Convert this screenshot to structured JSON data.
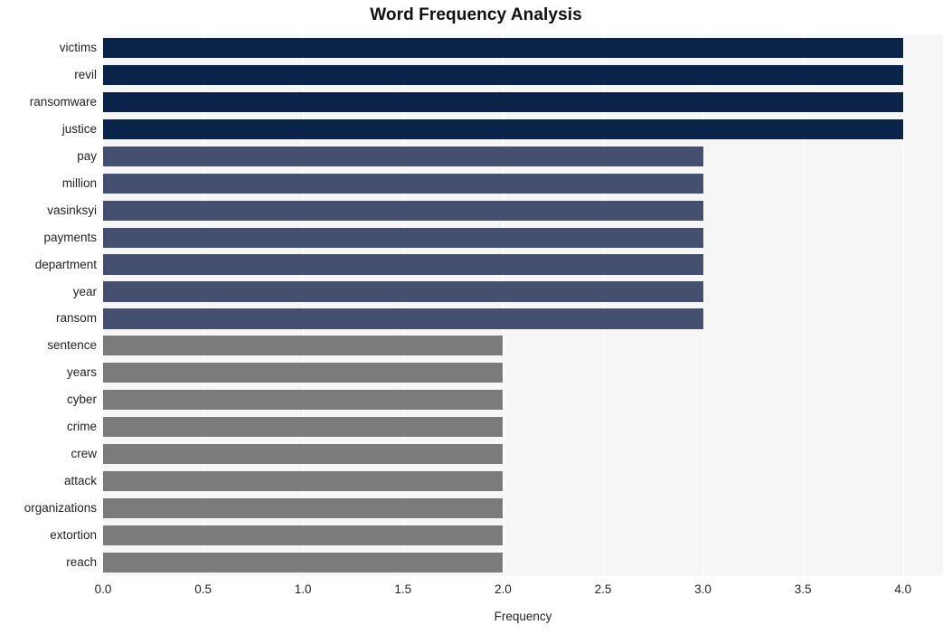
{
  "chart_data": {
    "type": "bar",
    "orientation": "horizontal",
    "title": "Word Frequency Analysis",
    "xlabel": "Frequency",
    "ylabel": "",
    "xlim": [
      0.0,
      4.2
    ],
    "ylim": null,
    "grid": true,
    "legend": null,
    "x_ticks": [
      "0.0",
      "0.5",
      "1.0",
      "1.5",
      "2.0",
      "2.5",
      "3.0",
      "3.5",
      "4.0"
    ],
    "x_tick_values": [
      0.0,
      0.5,
      1.0,
      1.5,
      2.0,
      2.5,
      3.0,
      3.5,
      4.0
    ],
    "categories": [
      "victims",
      "revil",
      "ransomware",
      "justice",
      "pay",
      "million",
      "vasinksyi",
      "payments",
      "department",
      "year",
      "ransom",
      "sentence",
      "years",
      "cyber",
      "crime",
      "crew",
      "attack",
      "organizations",
      "extortion",
      "reach"
    ],
    "values": [
      4,
      4,
      4,
      4,
      3,
      3,
      3,
      3,
      3,
      3,
      3,
      2,
      2,
      2,
      2,
      2,
      2,
      2,
      2,
      2
    ],
    "bar_colors": [
      "#0a2348",
      "#0a2348",
      "#0a2348",
      "#0a2348",
      "#454f70",
      "#454f70",
      "#454f70",
      "#454f70",
      "#454f70",
      "#454f70",
      "#454f70",
      "#7b7b7b",
      "#7b7b7b",
      "#7b7b7b",
      "#7b7b7b",
      "#7b7b7b",
      "#7b7b7b",
      "#7b7b7b",
      "#7b7b7b",
      "#7b7b7b"
    ]
  },
  "colors": {
    "plot_background": "#f6f6f7",
    "figure_background": "#ffffff",
    "gridline": "#ffffff",
    "tick_text": "#222222",
    "title_text": "#101010",
    "value_4_color": "#0a2348",
    "value_3_color": "#454f70",
    "value_2_color": "#7b7b7b"
  }
}
